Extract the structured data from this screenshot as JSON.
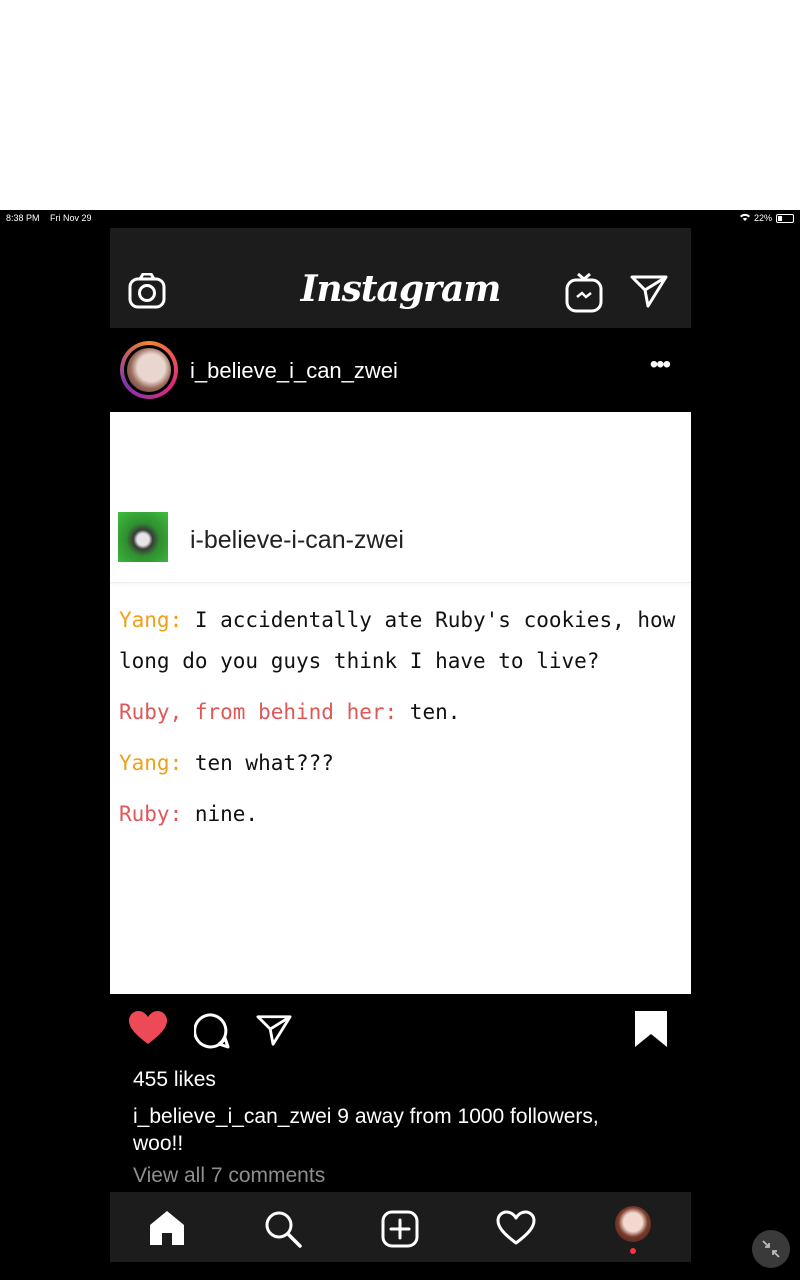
{
  "status_bar": {
    "time": "8:38 PM",
    "date": "Fri Nov 29",
    "battery": "22%"
  },
  "header": {
    "app_title": "Instagram",
    "icons": [
      "camera-icon",
      "igtv-icon",
      "direct-message-icon"
    ]
  },
  "post": {
    "username": "i_believe_i_can_zwei",
    "more_label": "•••",
    "image": {
      "tumblr_username": "i-believe-i-can-zwei",
      "lines": [
        {
          "speaker": "Yang:",
          "color": "#f0a018",
          "text": " I accidentally ate Ruby's cookies, how long do you guys think I have to live?"
        },
        {
          "speaker": "Ruby, from behind her:",
          "color": "#e05757",
          "text": " ten."
        },
        {
          "speaker": "Yang:",
          "color": "#f0a018",
          "text": " ten what???"
        },
        {
          "speaker": "Ruby:",
          "color": "#e05757",
          "text": " nine."
        }
      ]
    },
    "likes": "455 likes",
    "caption_user": "i_believe_i_can_zwei",
    "caption_text": " 9 away from 1000 followers, woo!!",
    "view_comments": "View all 7 comments",
    "liked": true
  },
  "colors": {
    "like_red": "#ed4956",
    "background": "#000000",
    "bar": "#1c1c1c"
  },
  "bottom_nav": [
    "home-icon",
    "search-icon",
    "new-post-icon",
    "activity-icon",
    "profile-icon"
  ]
}
